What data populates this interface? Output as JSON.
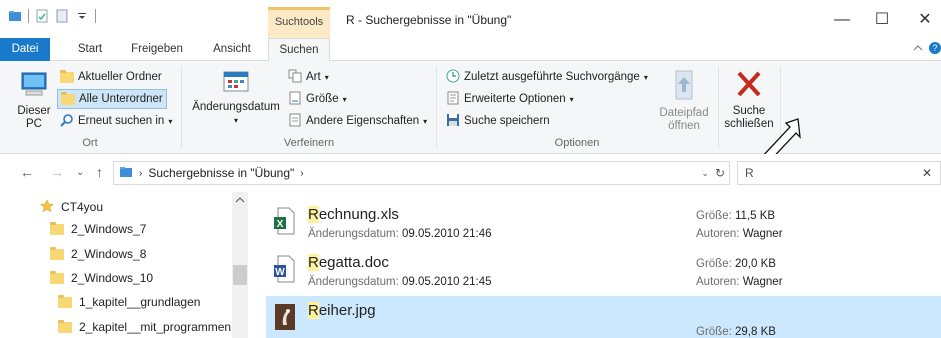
{
  "window": {
    "title": "R - Suchergebnisse in \"Übung\"",
    "context_tab": "Suchtools",
    "minimize": "—",
    "maximize": "☐",
    "close": "✕"
  },
  "tabs": {
    "file": "Datei",
    "start": "Start",
    "share": "Freigeben",
    "view": "Ansicht",
    "search": "Suchen"
  },
  "ribbon": {
    "ort": {
      "label": "Ort",
      "this_pc_line1": "Dieser",
      "this_pc_line2": "PC",
      "current_folder": "Aktueller Ordner",
      "all_subfolders": "Alle Unterordner",
      "search_again": "Erneut suchen in"
    },
    "verfeinern": {
      "label": "Verfeinern",
      "date_modified": "Änderungsdatum",
      "kind": "Art",
      "size": "Größe",
      "other_props": "Andere Eigenschaften"
    },
    "optionen": {
      "label": "Optionen",
      "recent_searches": "Zuletzt ausgeführte Suchvorgänge",
      "advanced": "Erweiterte Optionen",
      "save_search": "Suche speichern",
      "open_location_line1": "Dateipfad",
      "open_location_line2": "öffnen"
    },
    "close_search_line1": "Suche",
    "close_search_line2": "schließen"
  },
  "address": {
    "path": "Suchergebnisse in \"Übung\"",
    "search_value": "R"
  },
  "tree": {
    "items": [
      "CT4you",
      "2_Windows_7",
      "2_Windows_8",
      "2_Windows_10",
      "1_kapitel__grundlagen",
      "2_kapitel__mit_programmen"
    ]
  },
  "results": [
    {
      "hl": "R",
      "rest": "echnung.xls",
      "date_label": "Änderungsdatum:",
      "date": "09.05.2010 21:46",
      "size_label": "Größe:",
      "size": "11,5 KB",
      "author_label": "Autoren:",
      "author": "Wagner"
    },
    {
      "hl": "R",
      "rest": "egatta.doc",
      "date_label": "Änderungsdatum:",
      "date": "09.05.2010 21:45",
      "size_label": "Größe:",
      "size": "20,0 KB",
      "author_label": "Autoren:",
      "author": "Wagner"
    },
    {
      "hl": "R",
      "rest": "eiher.jpg",
      "size_label": "Größe:",
      "size": "29,8 KB"
    }
  ],
  "colors": {
    "accent": "#1979ca",
    "context_tab": "#fce9c6",
    "highlight": "#fff29c",
    "selection": "#cce8ff",
    "close_x": "#c42b1c"
  }
}
